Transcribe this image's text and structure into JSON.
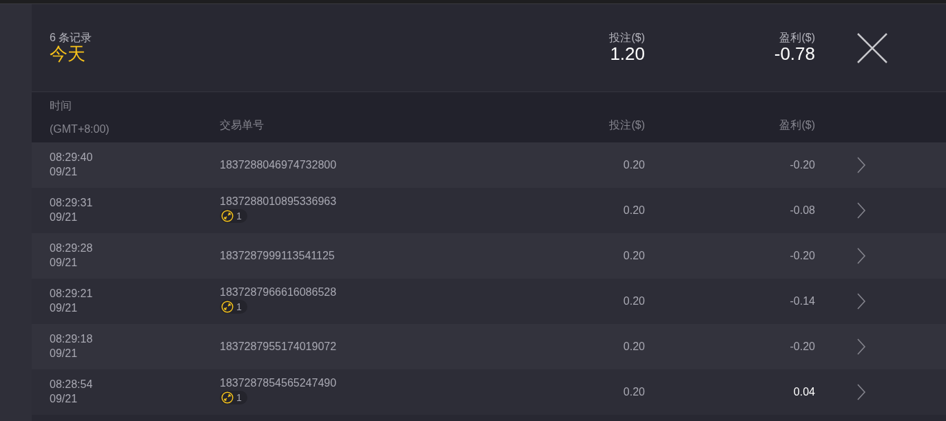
{
  "summary": {
    "record_count": "6 条记录",
    "period": "今天",
    "stake_label": "投注($)",
    "stake": "1.20",
    "profit_label": "盈利($)",
    "profit": "-0.78"
  },
  "columns": {
    "time": "时间",
    "timezone": "(GMT+8:00)",
    "order_id": "交易单号",
    "stake": "投注($)",
    "profit": "盈利($)"
  },
  "rows": [
    {
      "time": "08:29:40",
      "date": "09/21",
      "order_id": "1837288046974732800",
      "stake": "0.20",
      "profit": "-0.20",
      "gain": false
    },
    {
      "time": "08:29:31",
      "date": "09/21",
      "order_id": "1837288010895336963",
      "badge": "1",
      "stake": "0.20",
      "profit": "-0.08",
      "gain": false
    },
    {
      "time": "08:29:28",
      "date": "09/21",
      "order_id": "1837287999113541125",
      "stake": "0.20",
      "profit": "-0.20",
      "gain": false
    },
    {
      "time": "08:29:21",
      "date": "09/21",
      "order_id": "1837287966616086528",
      "badge": "1",
      "stake": "0.20",
      "profit": "-0.14",
      "gain": false
    },
    {
      "time": "08:29:18",
      "date": "09/21",
      "order_id": "1837287955174019072",
      "stake": "0.20",
      "profit": "-0.20",
      "gain": false
    },
    {
      "time": "08:28:54",
      "date": "09/21",
      "order_id": "1837287854565247490",
      "badge": "1",
      "stake": "0.20",
      "profit": "0.04",
      "gain": true
    }
  ]
}
